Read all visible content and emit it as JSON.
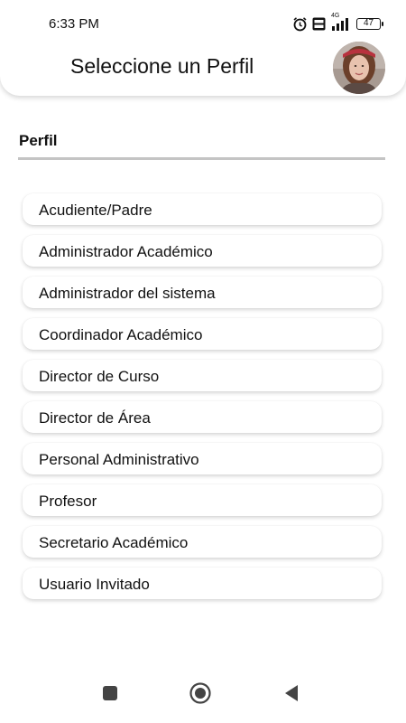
{
  "status_bar": {
    "time": "6:33 PM",
    "battery": "47",
    "network": "4G",
    "icons": [
      "alarm-icon",
      "volte-icon",
      "signal-icon",
      "battery-icon"
    ]
  },
  "header": {
    "title": "Seleccione un Perfil",
    "avatar": "user-avatar"
  },
  "section": {
    "label": "Perfil"
  },
  "profiles": [
    "Acudiente/Padre",
    "Administrador Académico",
    "Administrador del sistema",
    "Coordinador Académico",
    "Director de Curso",
    "Director de Área",
    "Personal Administrativo",
    "Profesor",
    "Secretario Académico",
    "Usuario Invitado"
  ],
  "nav": {
    "icons": [
      "recent-apps-icon",
      "home-icon",
      "back-icon"
    ]
  },
  "colors": {
    "background": "#ffffff",
    "divider": "#c4c4c4",
    "text": "#111111"
  }
}
